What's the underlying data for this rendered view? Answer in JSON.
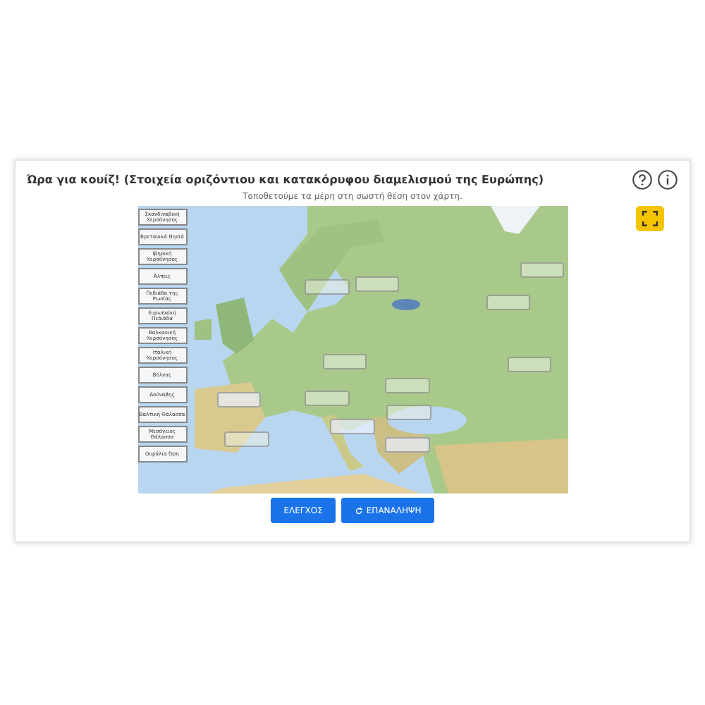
{
  "title": "Ώρα για κουίζ! (Στοιχεία οριζόντιου και κατακόρυφου διαμελισμού της Ευρώπης)",
  "instruction": "Τοποθετούμε τα μέρη στη σωστή θέση στον χάρτη.",
  "labels": [
    "Σκανδιναβική Χερσόνησος",
    "Βρετανικά Νησιά",
    "Ιβηρική Χερσόνησος",
    "Άλπεις",
    "Πεδιάδα της Ρωσίας",
    "Ευρωπαϊκή Πεδιάδα",
    "Βαλκανική Χερσόνησος",
    "Ιταλική Χερσόνησος",
    "Βόλγας",
    "Δούναβης",
    "Βαλτική Θάλασσα",
    "Μεσόγειος Θάλασσα",
    "Ουράλια Όρη"
  ],
  "buttons": [
    {
      "label": "ΕΛΕΓΧΟΣ",
      "kind": "check"
    },
    {
      "label": "ΕΠΑΝΑΛΗΨΗ",
      "kind": "repeat"
    }
  ]
}
